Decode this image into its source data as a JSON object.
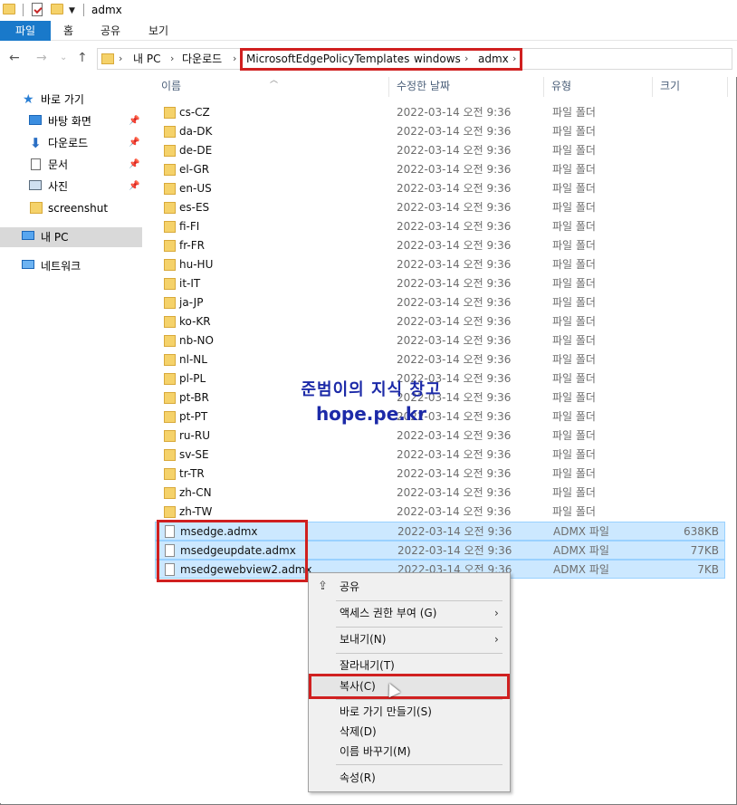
{
  "window": {
    "title": "admx"
  },
  "ribbon": {
    "tabs": [
      "파일",
      "홈",
      "공유",
      "보기"
    ]
  },
  "address": {
    "crumbs": [
      "내 PC",
      "다운로드",
      "MicrosoftEdgePolicyTemplates",
      "windows",
      "admx"
    ]
  },
  "nav": {
    "items": [
      {
        "label": "바로 가기",
        "icon": "star-icon"
      },
      {
        "label": "바탕 화면",
        "icon": "desktop-icon",
        "pinned": true
      },
      {
        "label": "다운로드",
        "icon": "download-icon",
        "pinned": true
      },
      {
        "label": "문서",
        "icon": "document-icon",
        "pinned": true
      },
      {
        "label": "사진",
        "icon": "picture-icon",
        "pinned": true
      },
      {
        "label": "screenshut",
        "icon": "folder-icon"
      },
      {
        "label": "내 PC",
        "icon": "computer-icon",
        "selected": true
      },
      {
        "label": "네트워크",
        "icon": "network-icon"
      }
    ]
  },
  "columns": {
    "name": "이름",
    "modified": "수정한 날짜",
    "type": "유형",
    "size": "크기"
  },
  "files": [
    {
      "name": "cs-CZ",
      "date": "2022-03-14 오전 9:36",
      "type": "파일 폴더",
      "size": "",
      "kind": "folder"
    },
    {
      "name": "da-DK",
      "date": "2022-03-14 오전 9:36",
      "type": "파일 폴더",
      "size": "",
      "kind": "folder"
    },
    {
      "name": "de-DE",
      "date": "2022-03-14 오전 9:36",
      "type": "파일 폴더",
      "size": "",
      "kind": "folder"
    },
    {
      "name": "el-GR",
      "date": "2022-03-14 오전 9:36",
      "type": "파일 폴더",
      "size": "",
      "kind": "folder"
    },
    {
      "name": "en-US",
      "date": "2022-03-14 오전 9:36",
      "type": "파일 폴더",
      "size": "",
      "kind": "folder"
    },
    {
      "name": "es-ES",
      "date": "2022-03-14 오전 9:36",
      "type": "파일 폴더",
      "size": "",
      "kind": "folder"
    },
    {
      "name": "fi-FI",
      "date": "2022-03-14 오전 9:36",
      "type": "파일 폴더",
      "size": "",
      "kind": "folder"
    },
    {
      "name": "fr-FR",
      "date": "2022-03-14 오전 9:36",
      "type": "파일 폴더",
      "size": "",
      "kind": "folder"
    },
    {
      "name": "hu-HU",
      "date": "2022-03-14 오전 9:36",
      "type": "파일 폴더",
      "size": "",
      "kind": "folder"
    },
    {
      "name": "it-IT",
      "date": "2022-03-14 오전 9:36",
      "type": "파일 폴더",
      "size": "",
      "kind": "folder"
    },
    {
      "name": "ja-JP",
      "date": "2022-03-14 오전 9:36",
      "type": "파일 폴더",
      "size": "",
      "kind": "folder"
    },
    {
      "name": "ko-KR",
      "date": "2022-03-14 오전 9:36",
      "type": "파일 폴더",
      "size": "",
      "kind": "folder"
    },
    {
      "name": "nb-NO",
      "date": "2022-03-14 오전 9:36",
      "type": "파일 폴더",
      "size": "",
      "kind": "folder"
    },
    {
      "name": "nl-NL",
      "date": "2022-03-14 오전 9:36",
      "type": "파일 폴더",
      "size": "",
      "kind": "folder"
    },
    {
      "name": "pl-PL",
      "date": "2022-03-14 오전 9:36",
      "type": "파일 폴더",
      "size": "",
      "kind": "folder"
    },
    {
      "name": "pt-BR",
      "date": "2022-03-14 오전 9:36",
      "type": "파일 폴더",
      "size": "",
      "kind": "folder"
    },
    {
      "name": "pt-PT",
      "date": "2022-03-14 오전 9:36",
      "type": "파일 폴더",
      "size": "",
      "kind": "folder"
    },
    {
      "name": "ru-RU",
      "date": "2022-03-14 오전 9:36",
      "type": "파일 폴더",
      "size": "",
      "kind": "folder"
    },
    {
      "name": "sv-SE",
      "date": "2022-03-14 오전 9:36",
      "type": "파일 폴더",
      "size": "",
      "kind": "folder"
    },
    {
      "name": "tr-TR",
      "date": "2022-03-14 오전 9:36",
      "type": "파일 폴더",
      "size": "",
      "kind": "folder"
    },
    {
      "name": "zh-CN",
      "date": "2022-03-14 오전 9:36",
      "type": "파일 폴더",
      "size": "",
      "kind": "folder"
    },
    {
      "name": "zh-TW",
      "date": "2022-03-14 오전 9:36",
      "type": "파일 폴더",
      "size": "",
      "kind": "folder"
    },
    {
      "name": "msedge.admx",
      "date": "2022-03-14 오전 9:36",
      "type": "ADMX 파일",
      "size": "638KB",
      "kind": "file",
      "selected": true
    },
    {
      "name": "msedgeupdate.admx",
      "date": "2022-03-14 오전 9:36",
      "type": "ADMX 파일",
      "size": "77KB",
      "kind": "file",
      "selected": true
    },
    {
      "name": "msedgewebview2.admx",
      "date": "2022-03-14 오전 9:36",
      "type": "ADMX 파일",
      "size": "7KB",
      "kind": "file",
      "selected": true
    }
  ],
  "watermark": {
    "line1": "준범이의 지식 창고",
    "line2": "hope.pe.kr"
  },
  "context_menu": {
    "items": [
      {
        "label": "공유",
        "icon": "share-icon"
      },
      {
        "label": "액세스 권한 부여 (G)",
        "submenu": true
      },
      {
        "label": "보내기(N)",
        "submenu": true
      },
      {
        "label": "잘라내기(T)"
      },
      {
        "label": "복사(C)",
        "hover": true
      },
      {
        "label": "바로 가기 만들기(S)"
      },
      {
        "label": "삭제(D)"
      },
      {
        "label": "이름 바꾸기(M)"
      },
      {
        "label": "속성(R)"
      }
    ]
  },
  "colors": {
    "accent": "#1979ca",
    "selection": "#cce8ff",
    "highlight_box": "#d02020",
    "watermark": "#1c2aa8"
  }
}
